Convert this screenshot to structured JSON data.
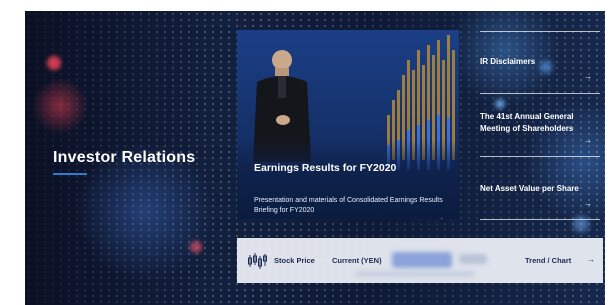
{
  "hero": {
    "title": "Investor Relations"
  },
  "feature_card": {
    "title": "Earnings Results for FY2020",
    "description": "Presentation and materials of Consolidated Earnings Results Briefing for FY2020",
    "arrow": "→"
  },
  "menu": {
    "items": [
      {
        "label": "IR Disclaimers",
        "arrow": "→"
      },
      {
        "label": "The 41st Annual General Meeting of Shareholders",
        "arrow": "→"
      },
      {
        "label": "Net Asset Value per Share",
        "arrow": "→"
      }
    ]
  },
  "stock_bar": {
    "stock_price_label": "Stock Price",
    "current_label": "Current (YEN)",
    "trend_label": "Trend / Chart",
    "arrow": "→"
  },
  "colors": {
    "accent_blue": "#2e7bd3",
    "card_blue": "#1b3f86",
    "stock_bar_bg": "#eceff6",
    "stock_text": "#1e2d54"
  }
}
